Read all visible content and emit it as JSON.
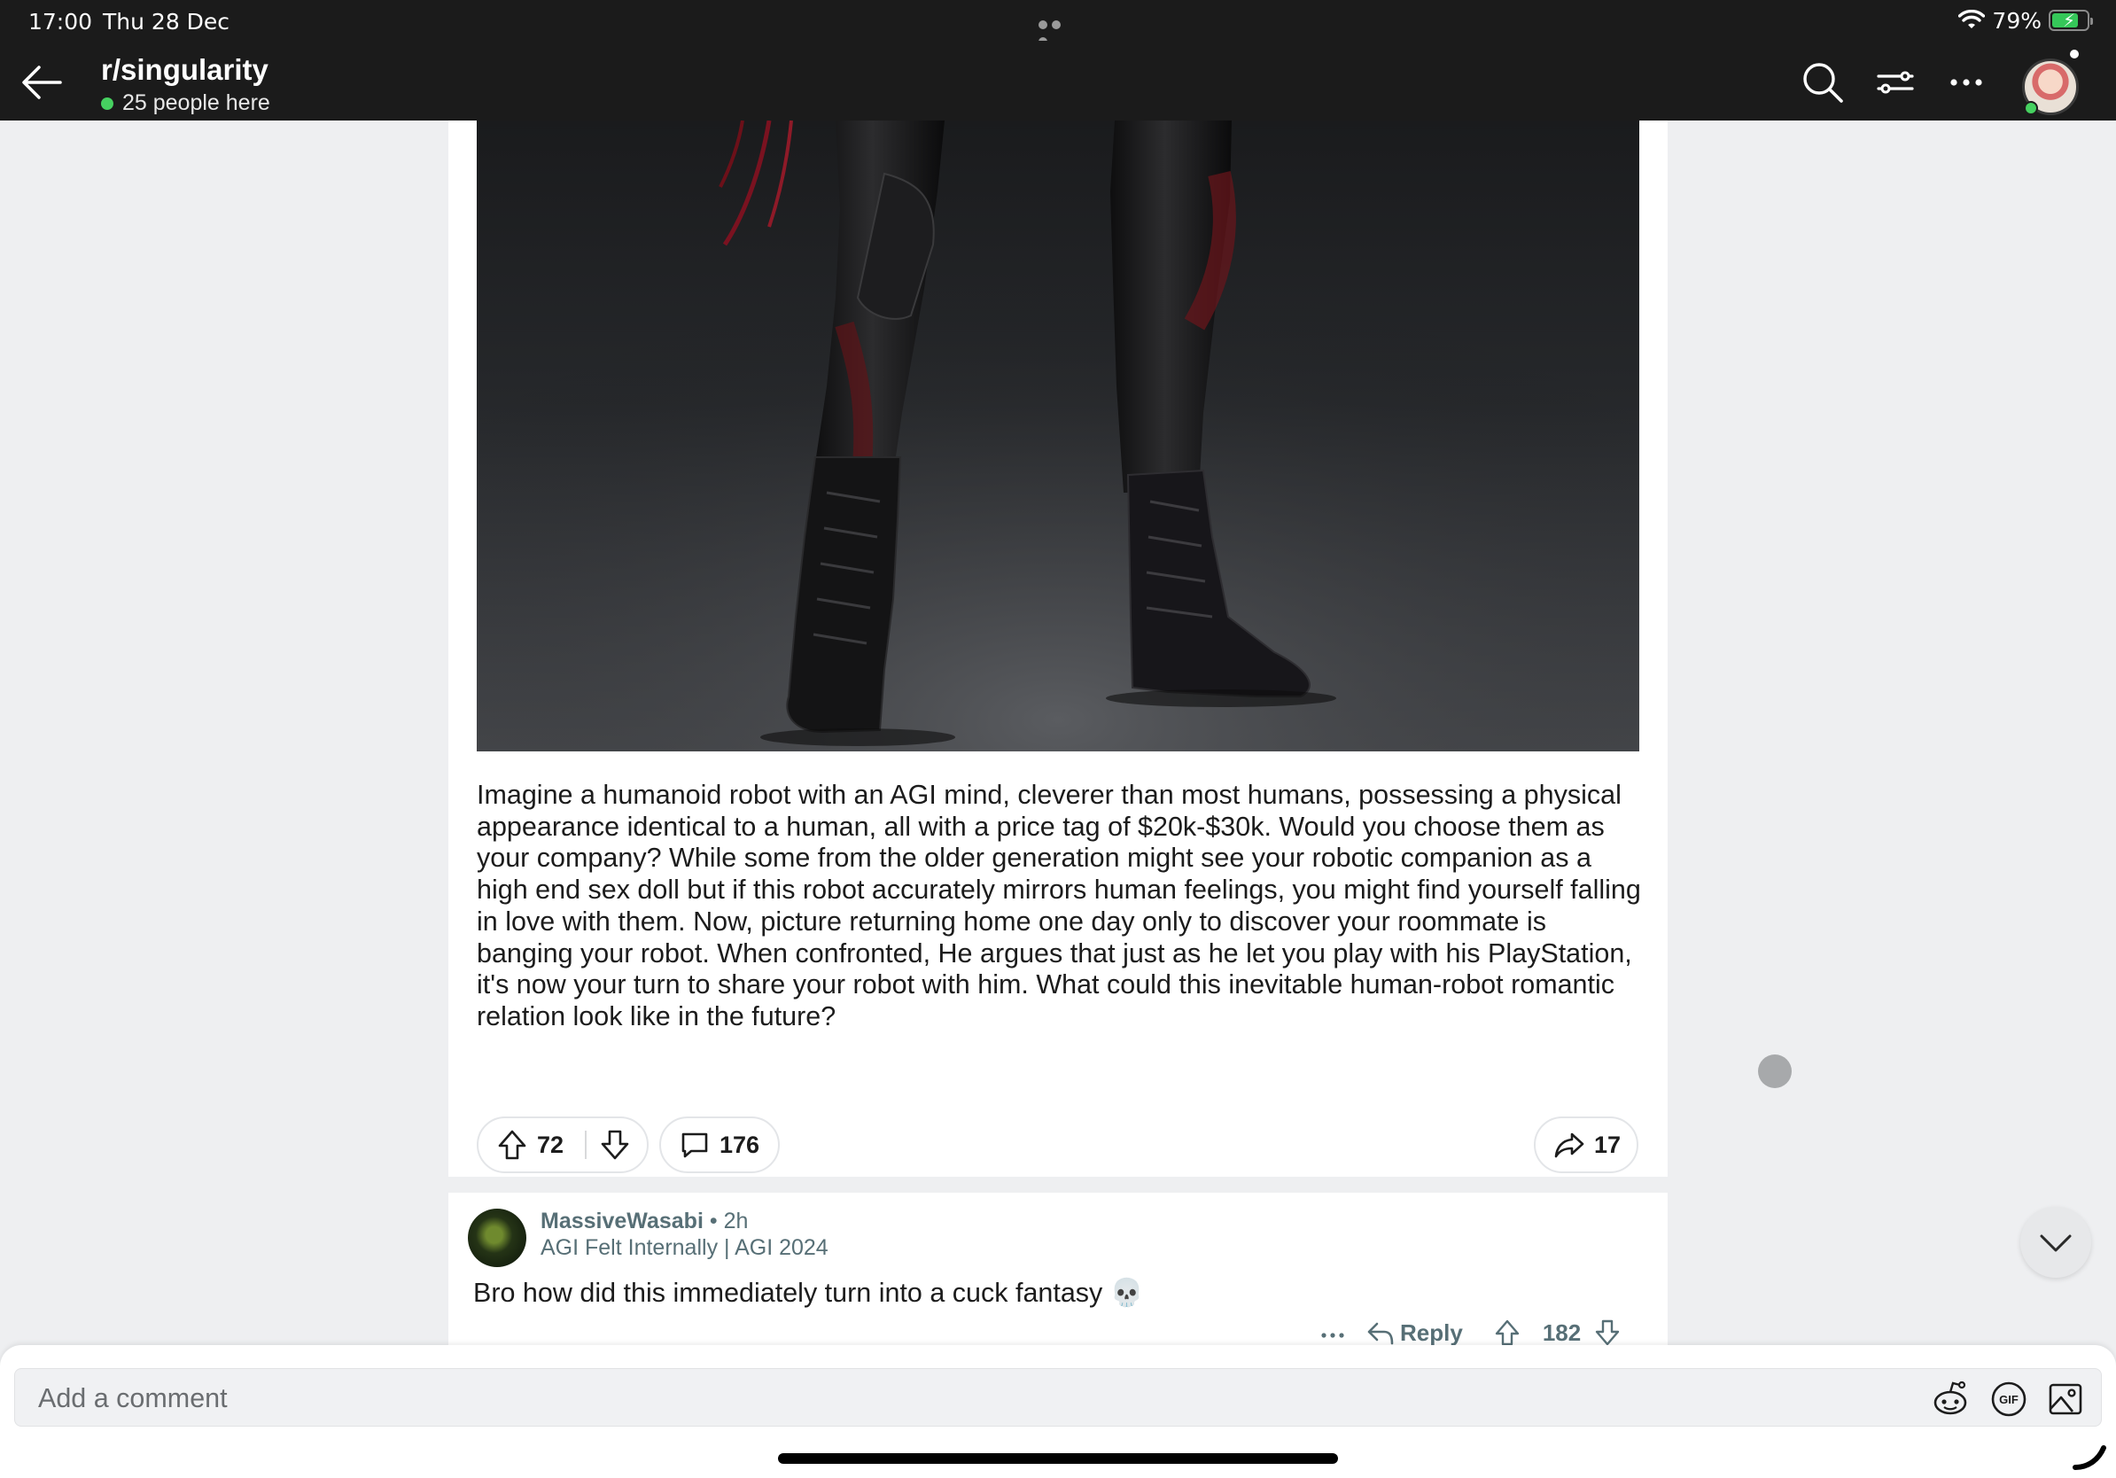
{
  "status_bar": {
    "time": "17:00",
    "date": "Thu 28 Dec",
    "battery": "79%",
    "battery_level": 0.79,
    "icons": [
      "wifi-icon",
      "battery-icon",
      "more-dots-icon"
    ]
  },
  "nav": {
    "title": "r/singularity",
    "online_text": "25 people here",
    "online_color": "#46d160",
    "icons": [
      "back-arrow-icon",
      "search-icon",
      "sort-filter-icon",
      "more-icon",
      "avatar"
    ]
  },
  "post": {
    "body": "Imagine a humanoid robot with an AGI mind, cleverer than most humans, possessing a physical appearance identical to a human, all with a price tag of $20k-$30k. Would you choose them as your company? While some from the older generation might see your robotic companion as a high end sex doll but if this robot accurately mirrors human feelings, you might find yourself falling in love with them. Now, picture returning home one day only to discover your roommate is banging your robot. When confronted, He argues that just as he let you play with his PlayStation, it's now your turn to share your robot with him. What could this inevitable human-robot romantic relation look like in the future?",
    "votes": "72",
    "comments": "176",
    "shares": "17"
  },
  "comment": {
    "author": "MassiveWasabi",
    "separator": "•",
    "age": "2h",
    "flair": "AGI Felt Internally | AGI 2024",
    "text": "Bro how did this immediately turn into a cuck fantasy 💀",
    "reply_label": "Reply",
    "score": "182"
  },
  "composer": {
    "placeholder": "Add a comment",
    "tools": [
      "snoo-emoji-icon",
      "gif-icon",
      "image-icon"
    ]
  }
}
